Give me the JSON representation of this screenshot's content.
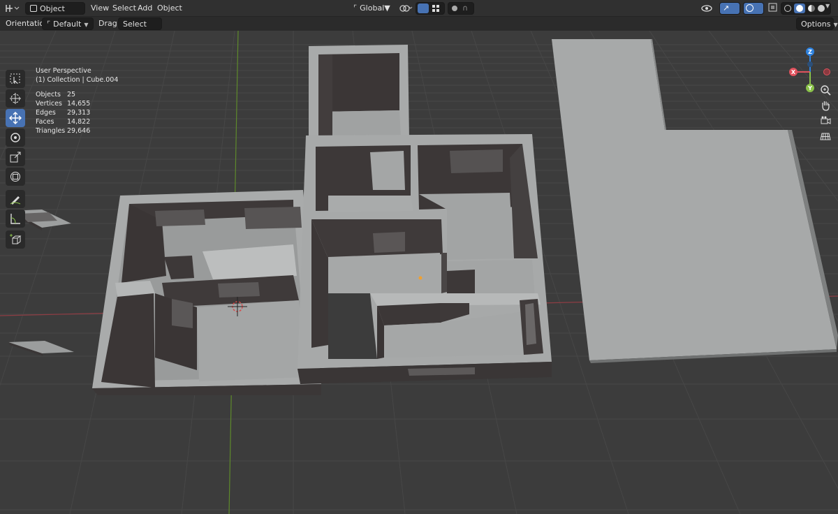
{
  "header": {
    "mode_label": "Object Mode",
    "menus": [
      "View",
      "Select",
      "Add",
      "Object"
    ],
    "transform_orientation": "Global",
    "options_label": "Options"
  },
  "tool_settings": {
    "orientation_label": "Orientation:",
    "orientation_value": "Default",
    "drag_label": "Drag:",
    "drag_value": "Select Box"
  },
  "overlay": {
    "view_name": "User Perspective",
    "collection": "(1) Collection | Cube.004",
    "stats": [
      {
        "label": "Objects",
        "value": "25"
      },
      {
        "label": "Vertices",
        "value": "14,655"
      },
      {
        "label": "Edges",
        "value": "29,313"
      },
      {
        "label": "Faces",
        "value": "14,822"
      },
      {
        "label": "Triangles",
        "value": "29,646"
      }
    ]
  },
  "gizmo": {
    "x": "X",
    "y": "Y",
    "z": "Z"
  },
  "colors": {
    "accent": "#4772b3",
    "x_axis": "#e0525d",
    "y_axis": "#8bc34a",
    "z_axis": "#2f83e0",
    "active_tool": "#4772b3"
  },
  "toolbar": [
    "select-box-icon",
    "cursor-icon",
    "move-icon",
    "rotate-icon",
    "scale-icon",
    "transform-icon",
    "annotate-icon",
    "measure-icon",
    "add-cube-icon"
  ]
}
